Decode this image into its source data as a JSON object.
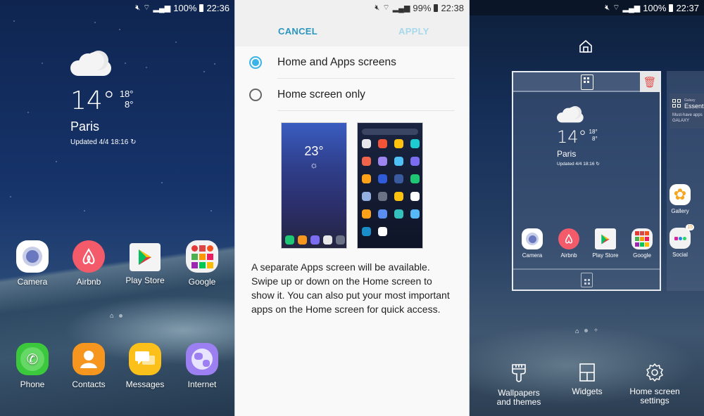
{
  "panels": {
    "home": {
      "status": {
        "mute": "mute-icon",
        "wifi": "wifi-icon",
        "signal": "signal-icon",
        "battery": "100%",
        "time": "22:36"
      },
      "weather": {
        "temp": "14°",
        "high": "18°",
        "low": "8°",
        "city": "Paris",
        "updated": "Updated 4/4  18:16"
      },
      "apps": [
        {
          "label": "Camera",
          "icon": "camera-icon"
        },
        {
          "label": "Airbnb",
          "icon": "airbnb-icon"
        },
        {
          "label": "Play Store",
          "icon": "play-store-icon"
        },
        {
          "label": "Google",
          "icon": "google-folder-icon"
        }
      ],
      "dock": [
        {
          "label": "Phone",
          "icon": "phone-icon"
        },
        {
          "label": "Contacts",
          "icon": "contacts-icon"
        },
        {
          "label": "Messages",
          "icon": "messages-icon"
        },
        {
          "label": "Internet",
          "icon": "internet-icon"
        }
      ]
    },
    "layout": {
      "status": {
        "battery": "99%",
        "time": "22:38"
      },
      "cancel": "CANCEL",
      "apply": "APPLY",
      "options": [
        {
          "label": "Home and Apps screens",
          "selected": true
        },
        {
          "label": "Home screen only",
          "selected": false
        }
      ],
      "preview_temp": "23°",
      "description": "A separate Apps screen will be available. Swipe up or down on the Home screen to show it. You can also put your most important apps on the Home screen for quick access.",
      "colors": {
        "accent": "#3ab4e6",
        "apply_disabled": "#a8d8ec"
      }
    },
    "edit": {
      "status": {
        "battery": "100%",
        "time": "22:37"
      },
      "weather": {
        "temp": "14°",
        "high": "18°",
        "low": "8°",
        "city": "Paris",
        "updated": "Updated 4/4  18:16"
      },
      "apps": [
        {
          "label": "Camera"
        },
        {
          "label": "Airbnb"
        },
        {
          "label": "Play Store"
        },
        {
          "label": "Google"
        }
      ],
      "next_page": {
        "widget_small": "Galaxy",
        "widget_title": "Essentials",
        "widget_sub": "Must-have apps",
        "widget_brand": "GALAXY",
        "gallery": "Gallery",
        "social": "Social",
        "social_badge": "15"
      },
      "actions": [
        {
          "label": "Wallpapers and themes",
          "icon": "paintbrush-icon"
        },
        {
          "label": "Widgets",
          "icon": "widgets-icon"
        },
        {
          "label": "Home screen settings",
          "icon": "gear-icon"
        }
      ]
    }
  }
}
